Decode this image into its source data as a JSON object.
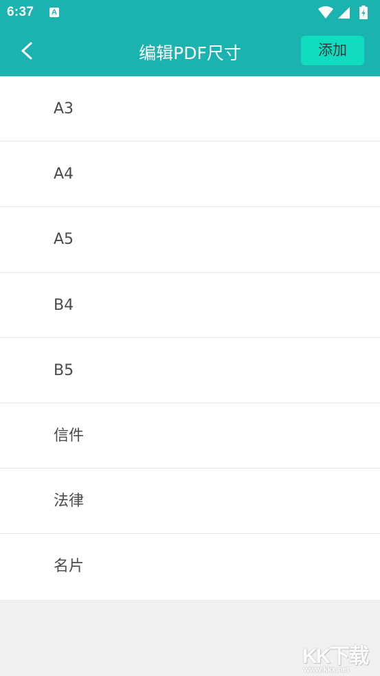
{
  "status_bar": {
    "time": "6:37",
    "app_icon_letter": "A",
    "icons": [
      "wifi-icon",
      "signal-icon",
      "battery-icon"
    ]
  },
  "app_bar": {
    "title": "编辑PDF尺寸",
    "back_icon": "chevron-left-icon",
    "add_label": "添加"
  },
  "sizes": [
    {
      "label": "A3"
    },
    {
      "label": "A4"
    },
    {
      "label": "A5"
    },
    {
      "label": "B4"
    },
    {
      "label": "B5"
    },
    {
      "label": "信件"
    },
    {
      "label": "法律"
    },
    {
      "label": "名片"
    }
  ],
  "watermark": {
    "logo": "KK下载",
    "url": "www.kkx.net"
  },
  "colors": {
    "primary": "#1bb3b0",
    "add_button": "#12dcc0",
    "background": "#f0f0f0",
    "divider": "#e6e6e6"
  }
}
